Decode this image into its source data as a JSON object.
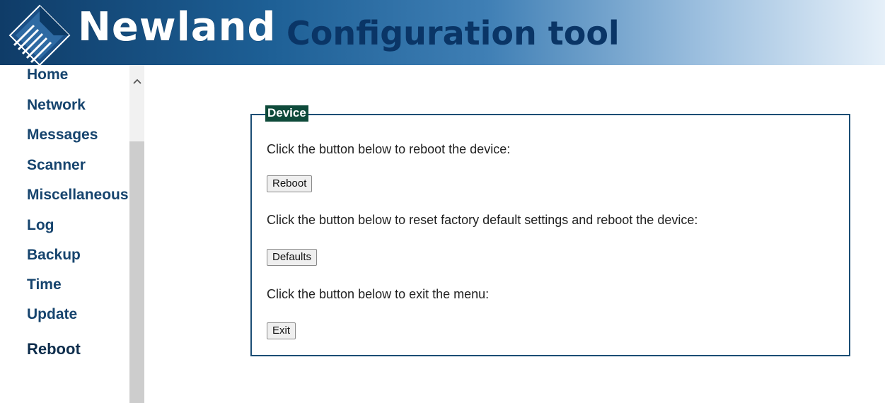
{
  "header": {
    "brand": "Newland",
    "subtitle": "Configuration tool",
    "logo_icon": "newland-diamond-logo-icon"
  },
  "nav": {
    "items": [
      {
        "label": "Home"
      },
      {
        "label": "Network"
      },
      {
        "label": "Messages"
      },
      {
        "label": "Scanner"
      },
      {
        "label": "Miscellaneous"
      },
      {
        "label": "Log"
      },
      {
        "label": "Backup"
      },
      {
        "label": "Time"
      },
      {
        "label": "Update"
      },
      {
        "label": "Reboot"
      }
    ],
    "current": "Reboot"
  },
  "scrollbar": {
    "up_icon": "chevron-up-icon"
  },
  "device": {
    "legend": "Device",
    "reboot_text": "Click the button below to reboot the device:",
    "reboot_button": "Reboot",
    "defaults_text": "Click the button below to reset factory default settings and reboot the device:",
    "defaults_button": "Defaults",
    "exit_text": "Click the button below to exit the menu:",
    "exit_button": "Exit"
  },
  "colors": {
    "nav_text": "#16446e",
    "legend_bg": "#0e4a3a",
    "box_border": "#1b4d74",
    "header_dark": "#0f3c68"
  }
}
